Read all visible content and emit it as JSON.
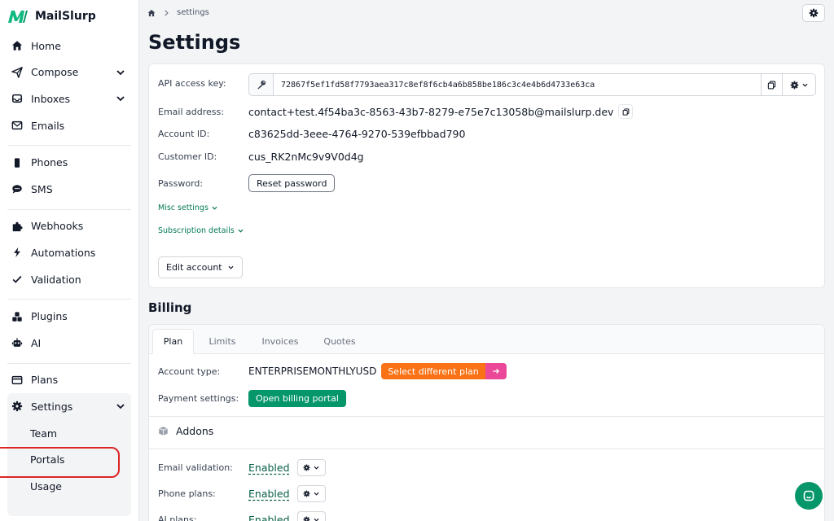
{
  "app": {
    "name": "MailSlurp",
    "brand_color": "#059669"
  },
  "sidebar": {
    "group1": [
      {
        "label": "Home",
        "icon": "home-icon"
      },
      {
        "label": "Compose",
        "icon": "send-icon",
        "expandable": true
      },
      {
        "label": "Inboxes",
        "icon": "inbox-icon",
        "expandable": true
      },
      {
        "label": "Emails",
        "icon": "envelope-icon"
      }
    ],
    "group2": [
      {
        "label": "Phones",
        "icon": "phone-icon"
      },
      {
        "label": "SMS",
        "icon": "chat-bubble-icon"
      }
    ],
    "group3": [
      {
        "label": "Webhooks",
        "icon": "puzzle-icon"
      },
      {
        "label": "Automations",
        "icon": "bolt-icon"
      },
      {
        "label": "Validation",
        "icon": "check-icon"
      }
    ],
    "group4": [
      {
        "label": "Plugins",
        "icon": "cubes-icon"
      },
      {
        "label": "AI",
        "icon": "robot-icon"
      }
    ],
    "group5": [
      {
        "label": "Plans",
        "icon": "credit-card-icon"
      },
      {
        "label": "Settings",
        "icon": "gear-icon",
        "expandable": true,
        "active": true
      }
    ],
    "settings_sub": [
      "Team",
      "Portals",
      "Usage"
    ],
    "highlighted_item": "Portals",
    "highlight_color": "#dc2626"
  },
  "breadcrumb": {
    "current": "settings"
  },
  "page": {
    "title": "Settings"
  },
  "account": {
    "api_key_label": "API access key:",
    "api_key": "72867f5ef1fd58f7793aea317c8ef8f6cb4a6b858be186c3c4e4b6d4733e63ca",
    "email_label": "Email address:",
    "email": "contact+test.4f54ba3c-8563-43b7-8279-e75e7c13058b@mailslurp.dev",
    "account_id_label": "Account ID:",
    "account_id": "c83625dd-3eee-4764-9270-539efbbad790",
    "customer_id_label": "Customer ID:",
    "customer_id": "cus_RK2nMc9v9V0d4g",
    "password_label": "Password:",
    "reset_password": "Reset password",
    "misc_settings": "Misc settings",
    "subscription_details": "Subscription details",
    "edit_account": "Edit account"
  },
  "billing": {
    "title": "Billing",
    "tabs": [
      "Plan",
      "Limits",
      "Invoices",
      "Quotes"
    ],
    "active_tab": "Plan",
    "account_type_label": "Account type:",
    "account_type": "ENTERPRISEMONTHLYUSD",
    "select_plan": "Select different plan",
    "payment_label": "Payment settings:",
    "billing_portal": "Open billing portal",
    "addons_title": "Addons",
    "addons": [
      {
        "label": "Email validation:",
        "status": "Enabled"
      },
      {
        "label": "Phone plans:",
        "status": "Enabled"
      },
      {
        "label": "AI plans:",
        "status": "Enabled"
      }
    ]
  }
}
